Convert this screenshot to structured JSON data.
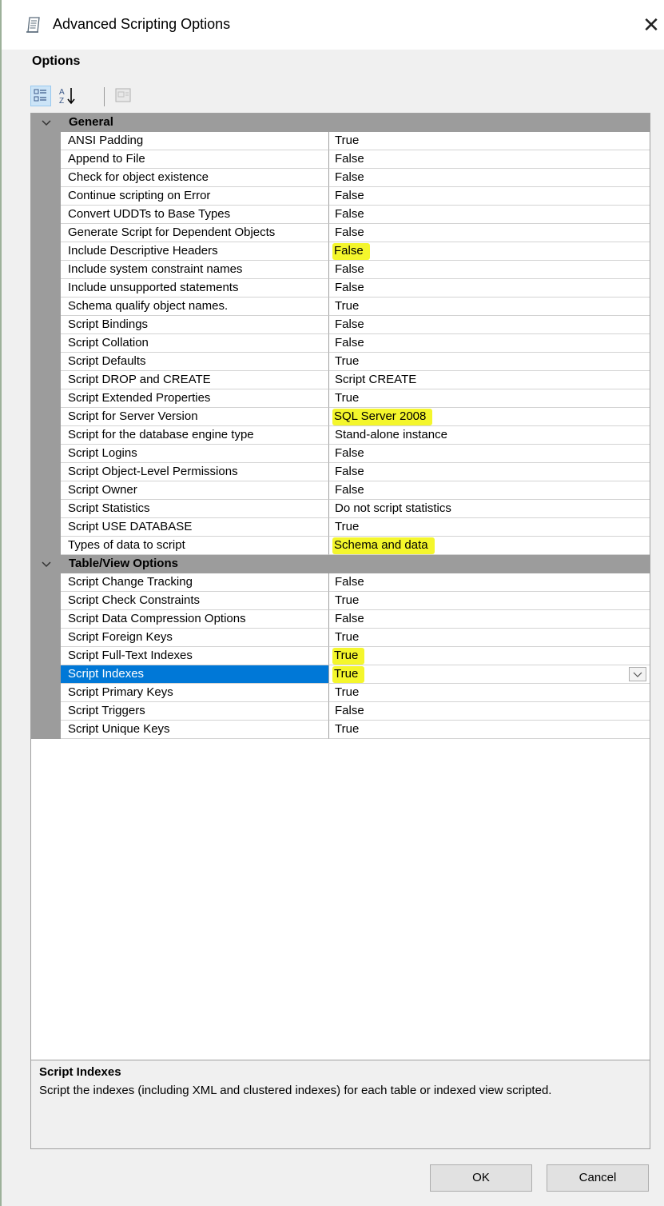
{
  "window": {
    "title": "Advanced Scripting Options",
    "close_glyph": "✕"
  },
  "section_label": "Options",
  "toolbar": {
    "buttons": [
      {
        "icon": "categorized-icon",
        "active": true
      },
      {
        "icon": "sort-alphabetical-icon",
        "active": false
      },
      {
        "icon": "property-pages-icon",
        "active": false
      }
    ]
  },
  "categories": [
    {
      "name": "General",
      "properties": [
        {
          "name": "ANSI Padding",
          "value": "True"
        },
        {
          "name": "Append to File",
          "value": "False"
        },
        {
          "name": "Check for object existence",
          "value": "False"
        },
        {
          "name": "Continue scripting on Error",
          "value": "False"
        },
        {
          "name": "Convert UDDTs to Base Types",
          "value": "False"
        },
        {
          "name": "Generate Script for Dependent Objects",
          "value": "False"
        },
        {
          "name": "Include Descriptive Headers",
          "value": "False",
          "highlight": true
        },
        {
          "name": "Include system constraint names",
          "value": "False"
        },
        {
          "name": "Include unsupported statements",
          "value": "False"
        },
        {
          "name": "Schema qualify object names.",
          "value": "True"
        },
        {
          "name": "Script Bindings",
          "value": "False"
        },
        {
          "name": "Script Collation",
          "value": "False"
        },
        {
          "name": "Script Defaults",
          "value": "True"
        },
        {
          "name": "Script DROP and CREATE",
          "value": "Script CREATE"
        },
        {
          "name": "Script Extended Properties",
          "value": "True"
        },
        {
          "name": "Script for Server Version",
          "value": "SQL Server 2008",
          "highlight": true
        },
        {
          "name": "Script for the database engine type",
          "value": "Stand-alone instance"
        },
        {
          "name": "Script Logins",
          "value": "False"
        },
        {
          "name": "Script Object-Level Permissions",
          "value": "False"
        },
        {
          "name": "Script Owner",
          "value": "False"
        },
        {
          "name": "Script Statistics",
          "value": "Do not script statistics"
        },
        {
          "name": "Script USE DATABASE",
          "value": "True"
        },
        {
          "name": "Types of data to script",
          "value": "Schema and data",
          "highlight": true
        }
      ]
    },
    {
      "name": "Table/View Options",
      "properties": [
        {
          "name": "Script Change Tracking",
          "value": "False"
        },
        {
          "name": "Script Check Constraints",
          "value": "True"
        },
        {
          "name": "Script Data Compression Options",
          "value": "False"
        },
        {
          "name": "Script Foreign Keys",
          "value": "True"
        },
        {
          "name": "Script Full-Text Indexes",
          "value": "True",
          "highlight": true
        },
        {
          "name": "Script Indexes",
          "value": "True",
          "highlight": true,
          "selected": true
        },
        {
          "name": "Script Primary Keys",
          "value": "True"
        },
        {
          "name": "Script Triggers",
          "value": "False"
        },
        {
          "name": "Script Unique Keys",
          "value": "True"
        }
      ]
    }
  ],
  "description": {
    "title": "Script Indexes",
    "text": "Script the indexes (including XML and clustered indexes) for each table or indexed view scripted."
  },
  "buttons": {
    "ok": "OK",
    "cancel": "Cancel"
  },
  "colors": {
    "selection": "#0078d7",
    "highlight": "#f4f62c",
    "category_band": "#9c9c9c"
  }
}
